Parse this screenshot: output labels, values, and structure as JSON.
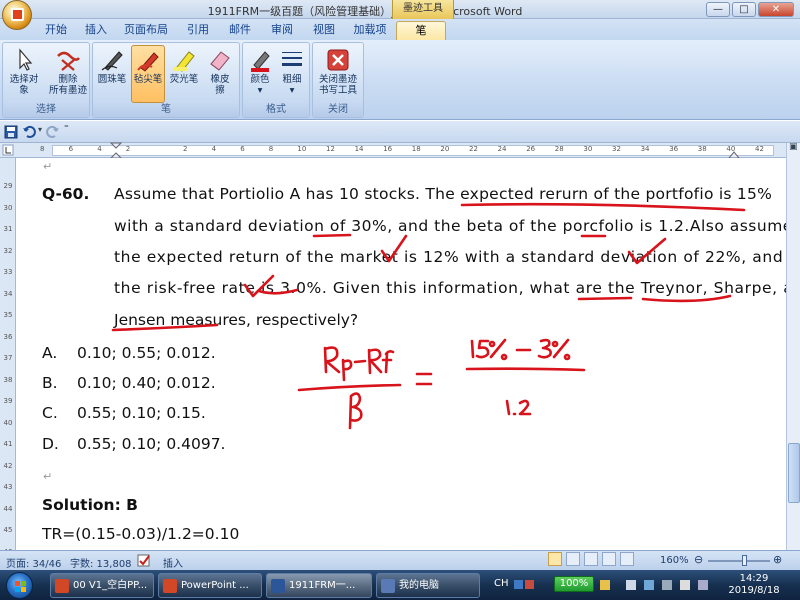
{
  "window": {
    "title": "1911FRM一级百题（风险管理基础）_授课版 - Microsoft Word",
    "contextual_tab_header": "墨迹工具",
    "minimize": "—",
    "maximize": "□",
    "close": "✕"
  },
  "tabs": [
    "开始",
    "插入",
    "页面布局",
    "引用",
    "邮件",
    "审阅",
    "视图",
    "加载项",
    "笔"
  ],
  "active_tab": "笔",
  "ribbon": {
    "groups": [
      {
        "label": "选择",
        "buttons": [
          {
            "label": "选择对象"
          },
          {
            "label": "删除\n所有墨迹"
          }
        ]
      },
      {
        "label": "笔",
        "buttons": [
          {
            "label": "圆珠笔"
          },
          {
            "label": "毡尖笔"
          },
          {
            "label": "荧光笔"
          },
          {
            "label": "橡皮\n擦"
          }
        ]
      },
      {
        "label": "格式",
        "buttons": [
          {
            "label": "颜色"
          },
          {
            "label": "粗细"
          }
        ]
      },
      {
        "label": "关闭",
        "buttons": [
          {
            "label": "关闭墨迹\n书写工具"
          }
        ]
      }
    ],
    "selected_button": "毡尖笔"
  },
  "ruler": {
    "h_numbers": [
      "8",
      "6",
      "4",
      "2",
      "",
      "2",
      "4",
      "6",
      "8",
      "10",
      "12",
      "14",
      "16",
      "18",
      "20",
      "22",
      "24",
      "26",
      "28",
      "30",
      "32",
      "34",
      "36",
      "38",
      "40",
      "42"
    ],
    "v_numbers": [
      "29",
      "30",
      "31",
      "32",
      "33",
      "34",
      "35",
      "36",
      "37",
      "38",
      "39",
      "40",
      "41",
      "42",
      "43",
      "44",
      "45",
      "46"
    ]
  },
  "document": {
    "question_number": "Q-60.",
    "question_lines": [
      "Assume that Portiolio A has 10 stocks. The expected rerurn of the portfofio is 15%",
      "with a standard deviation of 30%, and the beta of the porcfolio is 1.2.Also assume that",
      "the expected return of the market is 12% with a standard deviation of 22%, and that",
      "the risk-free rate is 3.0%. Given this information, what are the Treynor, Sharpe, and",
      "Jensen measures, respectively?"
    ],
    "options": [
      {
        "letter": "A.",
        "text": "0.10; 0.55; 0.012."
      },
      {
        "letter": "B.",
        "text": "0.10; 0.40; 0.012."
      },
      {
        "letter": "C.",
        "text": "0.55; 0.10; 0.15."
      },
      {
        "letter": "D.",
        "text": "0.55; 0.10; 0.4097."
      }
    ],
    "solution": "Solution: B",
    "solution_line": "TR=(0.15-0.03)/1.2=0.10",
    "paragraph_mark": "↵",
    "ink_color": "#d8131b",
    "ink_text": {
      "numerator_left": "Rp-Rf",
      "denominator_left": "β",
      "equals": "=",
      "numerator_right": "15% - 3%",
      "denominator_right": "1.2"
    }
  },
  "statusbar": {
    "page": "页面: 34/46",
    "words": "字数: 13,808",
    "mode": "插入",
    "zoom": "160%",
    "zoom_level": 160
  },
  "taskbar": {
    "items": [
      {
        "label": "00 V1_空白PP...",
        "color": "#d24726"
      },
      {
        "label": "PowerPoint ...",
        "color": "#d24726"
      },
      {
        "label": "1911FRM一...",
        "color": "#2b579a",
        "active": true
      },
      {
        "label": "我的电脑",
        "color": "#5a7ab5"
      }
    ],
    "ime": "CH",
    "battery": "100%",
    "time": "14:29",
    "date": "2019/8/18"
  }
}
